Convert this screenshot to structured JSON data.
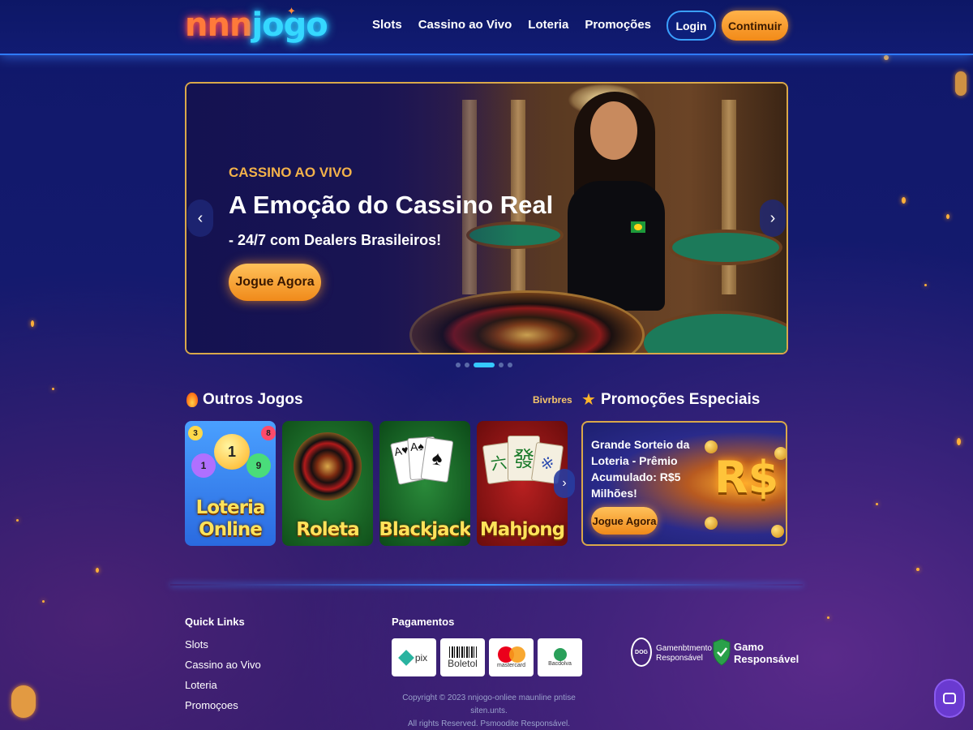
{
  "header": {
    "logo_part1": "nnn",
    "logo_part2": "jogo",
    "nav": [
      "Slots",
      "Cassino ao Vivo",
      "Loteria",
      "Promoções"
    ],
    "login_label": "Login",
    "continue_label": "Contimuir"
  },
  "hero": {
    "kicker": "CASSINO AO VIVO",
    "title": "A Emoção do Cassino Real",
    "subtitle": "- 24/7 com Dealers Brasileiros!",
    "cta_label": "Jogue Agora",
    "prev_icon": "chevron-left-icon",
    "next_icon": "chevron-right-icon",
    "slide_count": 5,
    "active_slide": 3
  },
  "games": {
    "title": "Outros Jogos",
    "see_all": "Bivrbres",
    "items": [
      {
        "label_line1": "Loteria",
        "label_line2": "Online"
      },
      {
        "label_line1": "Roleta",
        "label_line2": ""
      },
      {
        "label_line1": "Blackjack",
        "label_line2": ""
      },
      {
        "label_line1": "Mahjong",
        "label_line2": ""
      }
    ]
  },
  "promotions": {
    "title": "Promoções Especiais",
    "card_text": "Grande Sorteio da Loteria - Prêmio Acumulado: R$5 Milhões!",
    "currency_symbol": "R$",
    "cta_label": "Jogue Agora"
  },
  "footer": {
    "quick_links_title": "Quick Links",
    "quick_links": [
      "Slots",
      "Cassino ao Vivo",
      "Loteria",
      "Promoçoes"
    ],
    "payments_title": "Pagamentos",
    "payments": [
      "pix",
      "Boletol",
      "mastercard",
      "Bacdolva"
    ],
    "copyright_line1": "Copyright © 2023 nnjogo-onliee maunline pntise siten.unts.",
    "copyright_line2": "All rights Reserved. Psmoodite Responsável.",
    "badge1_logo": "DOG",
    "badge1_line1": "Gamenbtmento",
    "badge1_line2": "Responsável",
    "badge2_line1": "Gamo",
    "badge2_line2": "Responsável"
  },
  "colors": {
    "accent_orange": "#f5a02a",
    "accent_blue": "#35c8ff",
    "background": "#141a6e"
  }
}
